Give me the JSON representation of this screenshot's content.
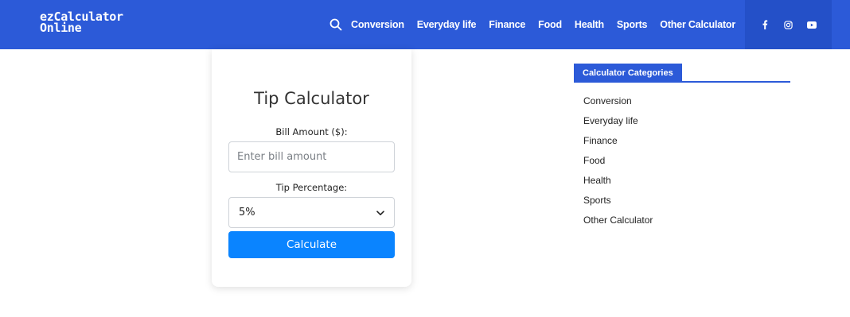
{
  "header": {
    "logo_line1": "ezCalculator",
    "logo_line2": "Online",
    "search_icon": "search-icon",
    "nav": [
      "Conversion",
      "Everyday life",
      "Finance",
      "Food",
      "Health",
      "Sports",
      "Other Calculator"
    ],
    "social_icons": [
      "facebook-icon",
      "instagram-icon",
      "youtube-icon"
    ],
    "bg_color": "#2c5ad8"
  },
  "calculator": {
    "title": "Tip Calculator",
    "bill_label": "Bill Amount ($):",
    "bill_placeholder": "Enter bill amount",
    "tip_label": "Tip Percentage:",
    "tip_selected": "5%",
    "button_label": "Calculate",
    "button_color": "#0a84ff"
  },
  "sidebar": {
    "heading": "Calculator Categories",
    "items": [
      "Conversion",
      "Everyday life",
      "Finance",
      "Food",
      "Health",
      "Sports",
      "Other Calculator"
    ]
  }
}
